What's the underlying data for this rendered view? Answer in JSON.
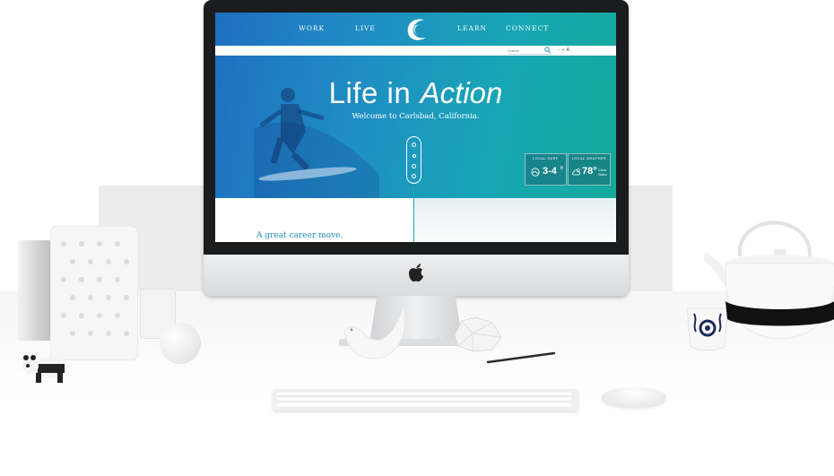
{
  "nav": {
    "left": [
      "WORK",
      "LIVE"
    ],
    "right": [
      "LEARN",
      "CONNECT"
    ]
  },
  "search": {
    "placeholder": "Search"
  },
  "text_size": {
    "minus": "-",
    "plus": "+",
    "a": "A"
  },
  "hero": {
    "title_plain": "Life in",
    "title_italic": "Action",
    "subtitle": "Welcome to Carlsbad, California."
  },
  "widgets": {
    "surf": {
      "label": "LOCAL SURF",
      "value": "3-4",
      "unit": "ft"
    },
    "weather": {
      "label": "LOCAL WEATHER",
      "value": "78°",
      "desc": "Clear Skies"
    }
  },
  "content": {
    "teaser": "A great career move."
  },
  "colors": {
    "hero_start": "#1f6fc0",
    "hero_end": "#14a99a",
    "accent": "#1f8fc0"
  },
  "icons": [
    "brand-c-logo",
    "search-icon",
    "apple-icon",
    "surf-icon",
    "weather-icon"
  ]
}
